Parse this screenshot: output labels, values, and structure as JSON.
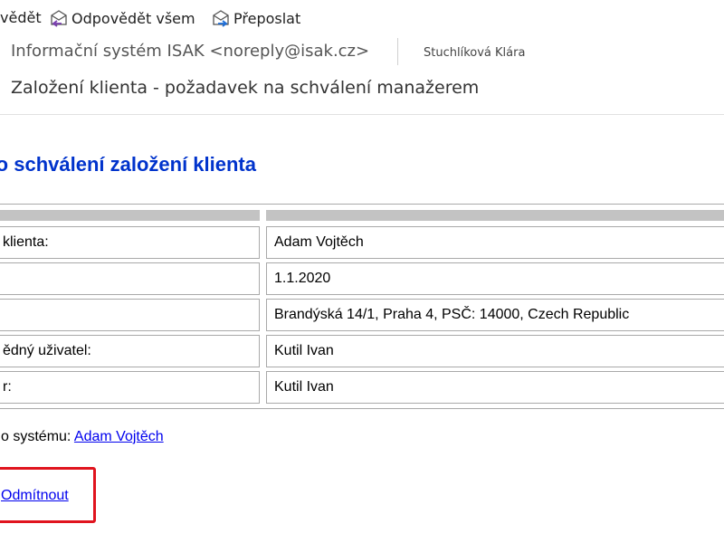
{
  "toolbar": {
    "reply_label": "vědět",
    "reply_all_label": "Odpovědět všem",
    "forward_label": "Přeposlat"
  },
  "message": {
    "sender": "Informační systém ISAK <noreply@isak.cz>",
    "recipient": "Stuchlíková Klára",
    "subject": "Založení klienta - požadavek na schválení manažerem"
  },
  "content": {
    "heading": "st o schválení založení klienta",
    "rows": [
      {
        "label": "klienta:",
        "value": "Adam Vojtěch"
      },
      {
        "label": "",
        "value": "1.1.2020"
      },
      {
        "label": "",
        "value": "Brandýská 14/1, Praha 4, PSČ: 14000, Czech Republic"
      },
      {
        "label": "ědný uživatel:",
        "value": "Kutil Ivan"
      },
      {
        "label": "r:",
        "value": "Kutil Ivan"
      }
    ],
    "system_link_prefix": "o systému:",
    "system_link_text": "Adam Vojtěch",
    "reject_link": "Odmítnout"
  },
  "colors": {
    "heading": "#0033cc",
    "link": "#0000ee",
    "highlight_box": "#e0141e",
    "table_header": "#c3c3c3"
  }
}
